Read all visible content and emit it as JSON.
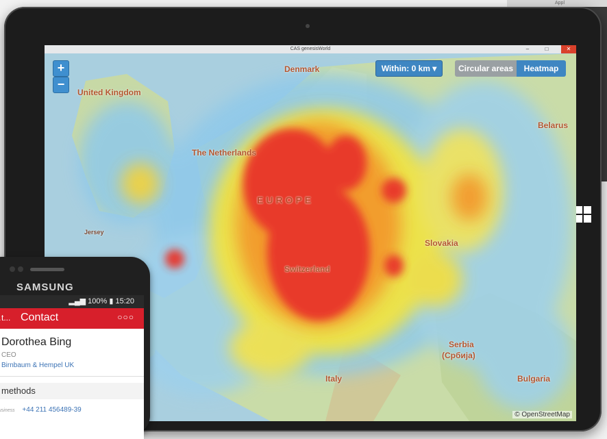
{
  "background_window": {
    "title": "Appl"
  },
  "window": {
    "title": "CAS genesisWorld"
  },
  "map": {
    "zoom_in": "+",
    "zoom_out": "−",
    "within_label": "Within: 0 km ▾",
    "view_toggle": {
      "left": "Circular areas",
      "right": "Heatmap",
      "active": "Heatmap"
    },
    "labels": [
      "United Kingdom",
      "The Netherlands",
      "EUROPE",
      "Switzerland",
      "Slovakia",
      "Serbia",
      "(Србија)",
      "Italy",
      "Bulgaria",
      "Belarus",
      "Jersey",
      "Denmark"
    ],
    "attribution": "© OpenStreetMap",
    "accent_color": "#3e86c2"
  },
  "phone": {
    "brand": "SAMSUNG",
    "status_text": "100% ▮ 15:20",
    "back_label": "…t...",
    "app_title": "Contact",
    "menu_icon": "more-icon",
    "contact": {
      "name": "Dorothea Bing",
      "role": "CEO",
      "company": "Birnbaum & Hempel UK"
    },
    "section_title": "methods",
    "phone_label": "business",
    "phone_number": "+44 211 456489-39",
    "app_color": "#d71f2b"
  }
}
